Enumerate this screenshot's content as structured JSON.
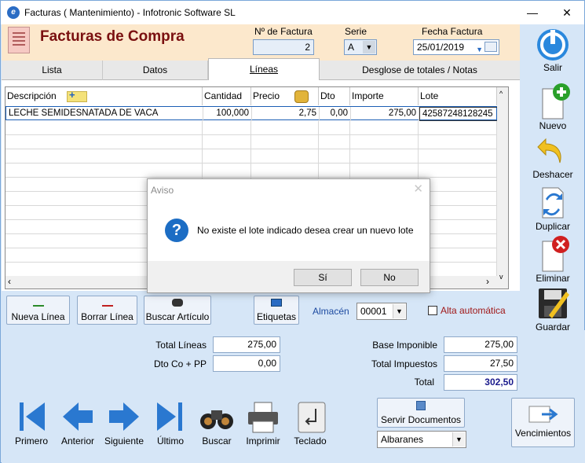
{
  "window": {
    "title": "Facturas ( Mantenimiento) - Infotronic Software SL"
  },
  "header": {
    "app_title": "Facturas de Compra",
    "num_factura_label": "Nº de Factura",
    "num_factura_value": "2",
    "serie_label": "Serie",
    "serie_value": "A",
    "fecha_label": "Fecha Factura",
    "fecha_value": "25/01/2019"
  },
  "tabs": [
    "Lista",
    "Datos",
    "Líneas",
    "Desglose de totales / Notas"
  ],
  "active_tab": "Líneas",
  "grid": {
    "columns": [
      "Descripción",
      "Cantidad",
      "Precio",
      "Dto",
      "Importe",
      "Lote"
    ],
    "rows": [
      {
        "descripcion": "LECHE SEMIDESNATADA DE VACA",
        "cantidad": "100,000",
        "precio": "2,75",
        "dto": "0,00",
        "importe": "275,00",
        "lote": "42587248128245"
      }
    ]
  },
  "line_buttons": {
    "nueva": "Nueva Línea",
    "borrar": "Borrar Línea",
    "buscar_articulo": "Buscar Artículo",
    "etiquetas": "Etiquetas"
  },
  "almacen": {
    "label": "Almacén",
    "value": "00001"
  },
  "alta_automatica": {
    "label": "Alta automática",
    "checked": false
  },
  "sidebar": {
    "salir": "Salir",
    "nuevo": "Nuevo",
    "deshacer": "Deshacer",
    "duplicar": "Duplicar",
    "eliminar": "Eliminar",
    "guardar": "Guardar"
  },
  "totals": {
    "total_lineas_label": "Total Líneas",
    "total_lineas": "275,00",
    "dto_label": "Dto Co + PP",
    "dto": "0,00",
    "base_label": "Base Imponible",
    "base": "275,00",
    "impuestos_label": "Total Impuestos",
    "impuestos": "27,50",
    "total_label": "Total",
    "total": "302,50"
  },
  "nav": {
    "primero": "Primero",
    "anterior": "Anterior",
    "siguiente": "Siguiente",
    "ultimo": "Último",
    "buscar": "Buscar",
    "imprimir": "Imprimir",
    "teclado": "Teclado"
  },
  "servir": {
    "label": "Servir Documentos",
    "select_value": "Albaranes"
  },
  "vencimientos": "Vencimientos",
  "dialog": {
    "title": "Aviso",
    "message": "No existe el lote indicado desea crear un nuevo lote",
    "yes": "Sí",
    "no": "No"
  },
  "colors": {
    "title_red": "#7a1010",
    "header_bg": "#fce8cc",
    "panel_bg": "#d6e6f7",
    "total_blue": "#1a1a8c"
  }
}
